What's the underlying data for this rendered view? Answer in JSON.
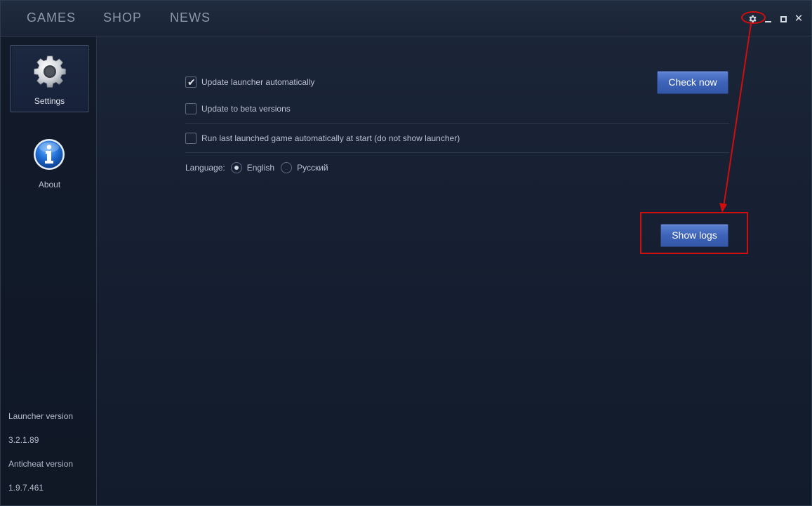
{
  "nav": {
    "tabs": [
      {
        "label": "GAMES"
      },
      {
        "label": "SHOP"
      },
      {
        "label": "NEWS"
      }
    ]
  },
  "window_controls": {
    "icons": [
      "gear-icon",
      "minimize-icon",
      "maximize-icon",
      "close-icon"
    ]
  },
  "sidebar": {
    "items": [
      {
        "label": "Settings",
        "icon": "gear-icon",
        "selected": true
      },
      {
        "label": "About",
        "icon": "info-icon",
        "selected": false
      }
    ],
    "launcher_version_label": "Launcher version",
    "launcher_version": "3.2.1.89",
    "anticheat_version_label": "Anticheat version",
    "anticheat_version": "1.9.7.461"
  },
  "settings": {
    "update_auto": {
      "label": "Update launcher automatically",
      "checked": true
    },
    "update_beta": {
      "label": "Update to beta versions",
      "checked": false
    },
    "run_last": {
      "label": "Run last launched game automatically at start (do not show launcher)",
      "checked": false
    },
    "language": {
      "label": "Language:",
      "options": [
        {
          "label": "English",
          "selected": true
        },
        {
          "label": "Русский",
          "selected": false
        }
      ]
    },
    "check_now_label": "Check now",
    "show_logs_label": "Show logs"
  },
  "annotation": {
    "color": "#d10d0d"
  },
  "colors": {
    "accent_button": "#3d63b8",
    "background": "#162032"
  }
}
